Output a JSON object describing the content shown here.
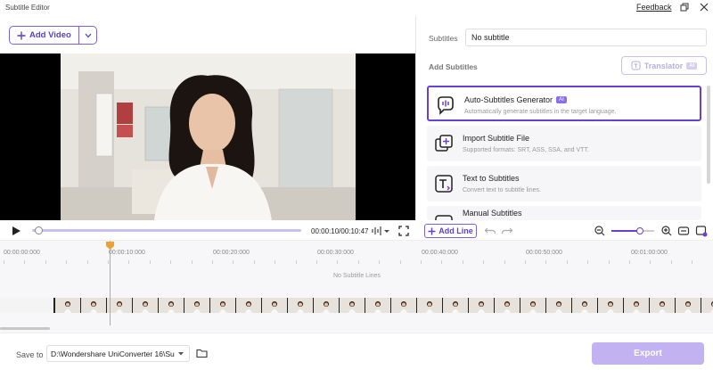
{
  "app": {
    "title": "Subtitle Editor",
    "feedback_label": "Feedback"
  },
  "toolbar": {
    "add_video_label": "Add Video"
  },
  "right_panel": {
    "subtitles_label": "Subtitles",
    "subtitles_value": "No subtitle",
    "add_subtitles_label": "Add Subtitles",
    "translator_label": "Translator",
    "translator_badge": "AI",
    "options": [
      {
        "title": "Auto-Subtitles Generator",
        "badge": "AI",
        "desc": "Automatically generate subtitles in the target language.",
        "icon": "speech-ai-icon"
      },
      {
        "title": "Import Subtitle File",
        "desc": "Supported formats: SRT, ASS, SSA, and VTT.",
        "icon": "import-file-icon"
      },
      {
        "title": "Text to Subtitles",
        "desc": "Convert text to subtitle lines.",
        "icon": "text-to-subtitles-icon"
      },
      {
        "title": "Manual Subtitles",
        "desc": "",
        "icon": "manual-subtitles-icon"
      }
    ]
  },
  "player": {
    "time": "00:00:10/00:10:47",
    "progress": 0.01,
    "zoom": 0.67
  },
  "editor": {
    "add_line_label": "Add Line"
  },
  "timeline": {
    "ruler": [
      "00:00:00:000",
      "00:00:10:000",
      "00:00:20:000",
      "00:00:30:000",
      "00:00:40:000",
      "00:00:50:000",
      "00:01:00:000"
    ],
    "empty_text": "No Subtitle Lines"
  },
  "footer": {
    "save_to_label": "Save to",
    "path_value": "D:\\Wondershare UniConverter 16\\Su",
    "export_label": "Export"
  },
  "colors": {
    "accent": "#6a3fd8",
    "export_disabled": "#c2b2f2",
    "playhead": "#f0a030"
  }
}
